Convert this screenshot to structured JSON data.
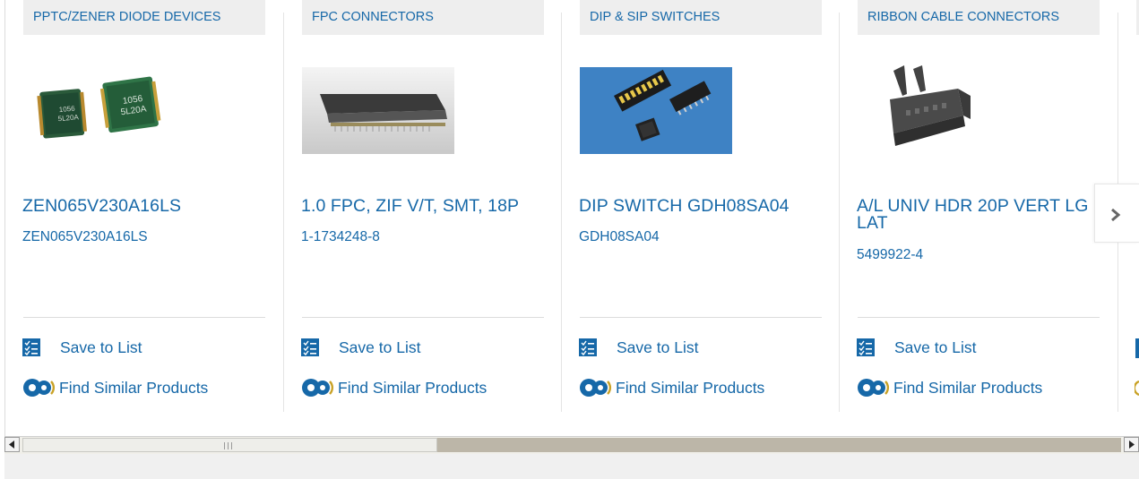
{
  "cards": [
    {
      "category": "PPTC/ZENER DIODE DEVICES",
      "name": "ZEN065V230A16LS",
      "part_no": "ZEN065V230A16LS",
      "save_label": "Save to List",
      "find_label": "Find Similar Products"
    },
    {
      "category": "FPC CONNECTORS",
      "name": "1.0 FPC, ZIF V/T, SMT, 18P",
      "part_no": "1-1734248-8",
      "save_label": "Save to List",
      "find_label": "Find Similar Products"
    },
    {
      "category": "DIP & SIP SWITCHES",
      "name": "DIP SWITCH GDH08SA04",
      "part_no": "GDH08SA04",
      "save_label": "Save to List",
      "find_label": "Find Similar Products"
    },
    {
      "category": "RIBBON CABLE CONNECTORS",
      "name": "A/L UNIV HDR 20P VERT LG LAT",
      "part_no": "5499922-4",
      "save_label": "Save to List",
      "find_label": "Find Similar Products"
    }
  ],
  "colors": {
    "link": "#1668a8",
    "tag_bg": "#eeeeee",
    "icon_gold": "#c9a227"
  },
  "icons": {
    "save": "checklist-icon",
    "find": "gears-icon",
    "next": "chevron-right-icon",
    "scroll_left": "scroll-left-arrow-icon",
    "scroll_right": "scroll-right-arrow-icon"
  }
}
